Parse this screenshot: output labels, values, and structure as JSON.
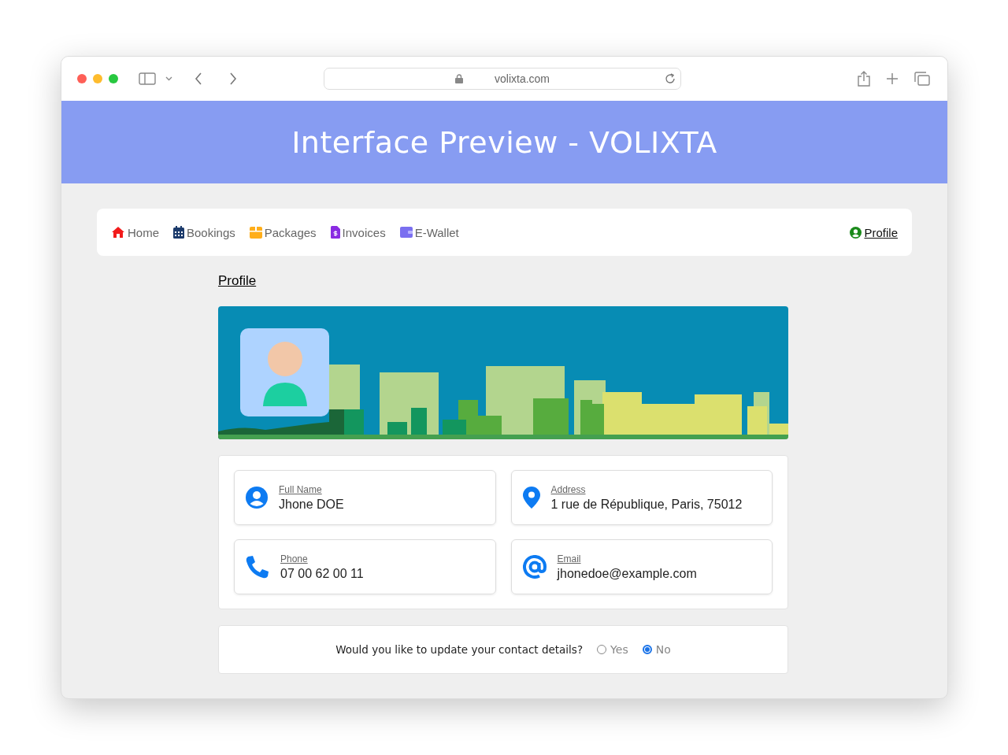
{
  "browser": {
    "url": "volixta.com"
  },
  "header": {
    "title": "Interface Preview - VOLIXTA"
  },
  "nav": {
    "items": [
      {
        "label": "Home"
      },
      {
        "label": "Bookings"
      },
      {
        "label": "Packages"
      },
      {
        "label": "Invoices"
      },
      {
        "label": "E-Wallet"
      }
    ],
    "profile_link": "Profile"
  },
  "page_title": "Profile",
  "details": [
    {
      "label": "Full Name",
      "value": "Jhone DOE"
    },
    {
      "label": "Address",
      "value": "1 rue de République, Paris, 75012"
    },
    {
      "label": "Phone",
      "value": "07 00 62 00 11"
    },
    {
      "label": "Email",
      "value": "jhonedoe@example.com"
    }
  ],
  "update_question": {
    "text": "Would you like to update your contact details?",
    "options": [
      {
        "label": "Yes",
        "selected": false
      },
      {
        "label": "No",
        "selected": true
      }
    ]
  }
}
